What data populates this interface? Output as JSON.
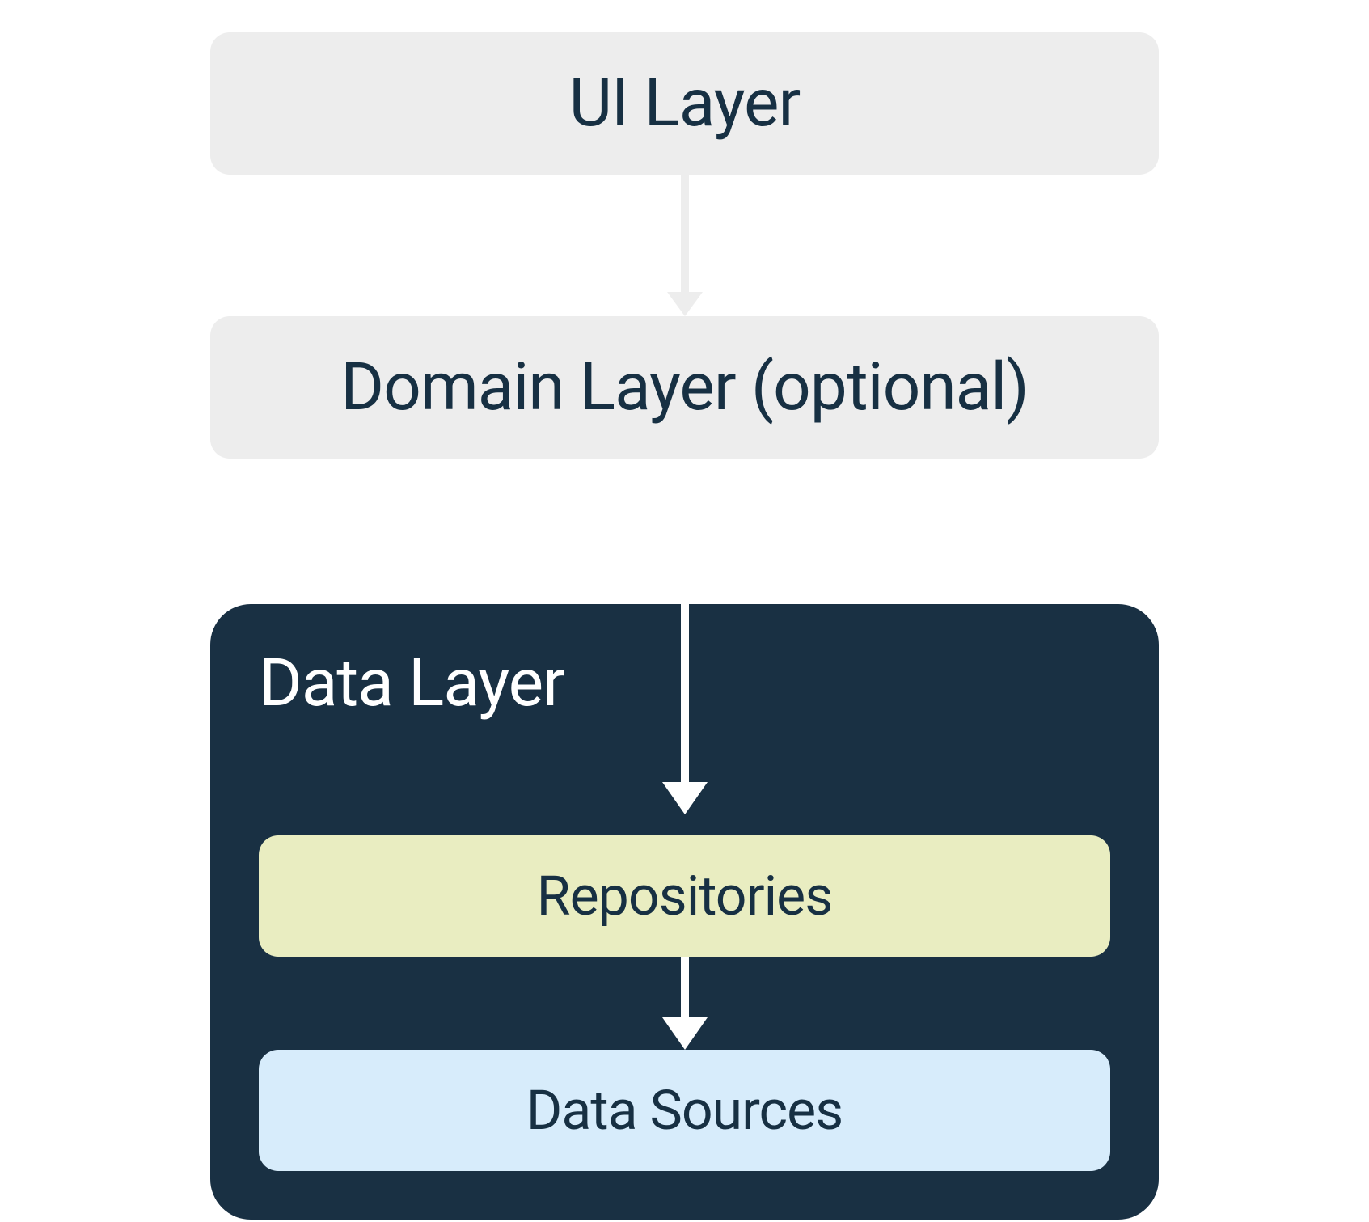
{
  "layers": {
    "ui": "UI Layer",
    "domain": "Domain Layer (optional)",
    "data": {
      "title": "Data Layer",
      "repositories": "Repositories",
      "dataSources": "Data Sources"
    }
  },
  "colors": {
    "lightBox": "#ededed",
    "darkContainer": "#193043",
    "repositories": "#e9edc1",
    "dataSources": "#d7ecfb",
    "textDark": "#173043",
    "textLight": "#ffffff"
  }
}
